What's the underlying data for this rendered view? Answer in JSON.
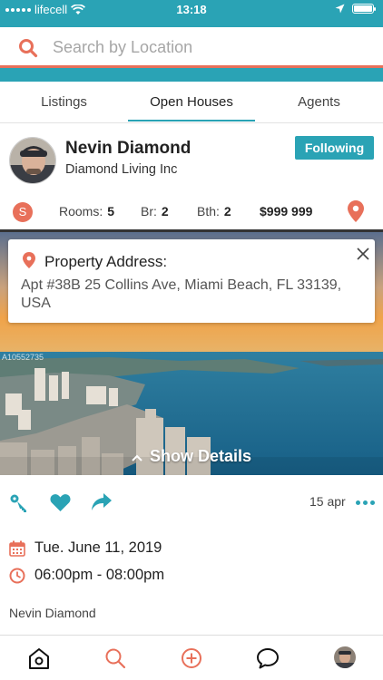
{
  "status_bar": {
    "carrier": "lifecell",
    "time": "13:18",
    "icons": [
      "signal-dots-icon",
      "wifi-icon",
      "location-arrow-icon",
      "battery-icon"
    ]
  },
  "search": {
    "placeholder": "Search by Location",
    "icon": "search-icon"
  },
  "tabs": [
    {
      "label": "Listings",
      "active": false
    },
    {
      "label": "Open Houses",
      "active": true
    },
    {
      "label": "Agents",
      "active": false
    }
  ],
  "agent": {
    "name": "Nevin Diamond",
    "company": "Diamond Living Inc",
    "follow_label": "Following"
  },
  "listing": {
    "badge": "S",
    "rooms_label": "Rooms:",
    "rooms": "5",
    "br_label": "Br:",
    "br": "2",
    "bth_label": "Bth:",
    "bth": "2",
    "price": "$999 999"
  },
  "address_card": {
    "title": "Property Address:",
    "text": "Apt #38B 25 Collins Ave, Miami Beach, FL 33139, USA"
  },
  "photo": {
    "watermark": "A10552735",
    "show_details_label": "Show Details"
  },
  "actions": {
    "date": "15 apr",
    "icons": [
      "key-icon",
      "heart-icon",
      "share-icon",
      "more-icon"
    ]
  },
  "event": {
    "date": "Tue. June 11, 2019",
    "time": "06:00pm - 08:00pm",
    "host": "Nevin Diamond"
  },
  "bottom_nav": [
    "home-icon",
    "search-icon",
    "add-icon",
    "chat-icon",
    "profile-avatar"
  ],
  "colors": {
    "teal": "#2aa3b5",
    "coral": "#e8705a"
  }
}
